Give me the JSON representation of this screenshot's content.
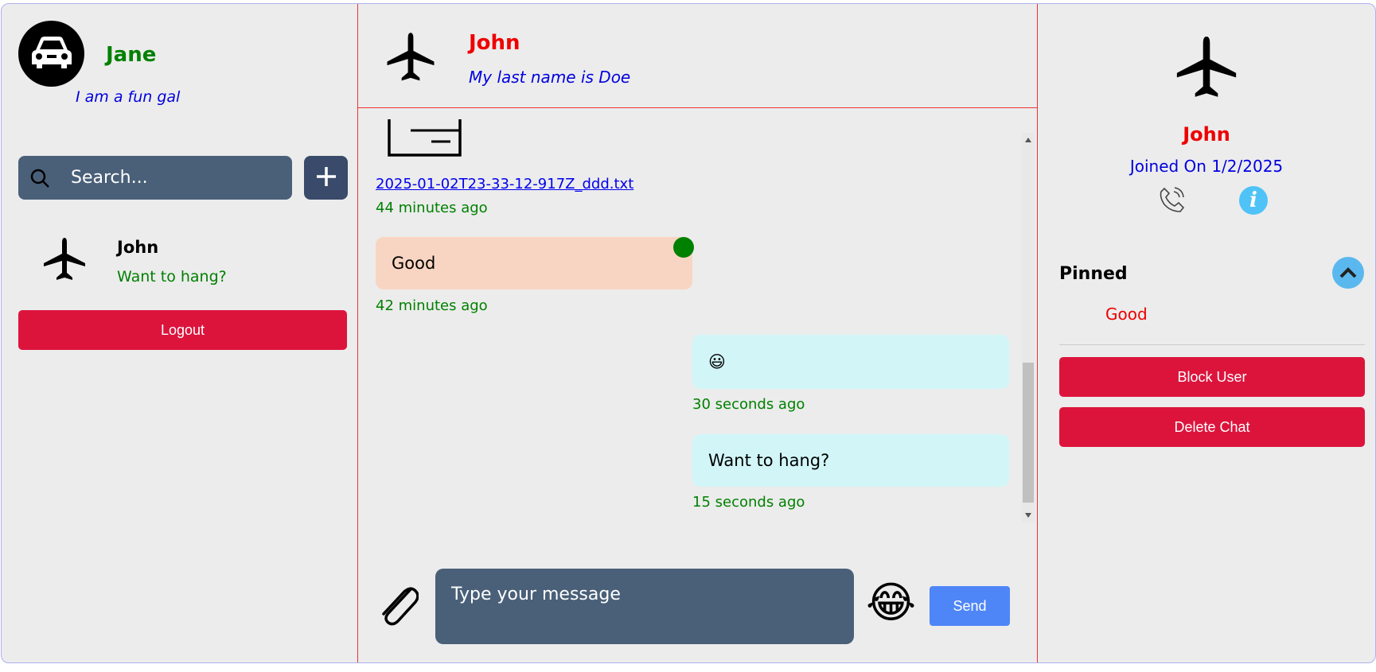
{
  "me": {
    "name": "Jane",
    "status": "I am a fun gal",
    "avatar_icon": "car-icon"
  },
  "search": {
    "placeholder": "Search..."
  },
  "contacts": [
    {
      "name": "John",
      "last_message": "Want to hang?",
      "avatar_icon": "airplane-icon"
    }
  ],
  "logout_label": "Logout",
  "chat": {
    "header": {
      "name": "John",
      "subtitle": "My last name is Doe"
    },
    "messages": [
      {
        "type": "file",
        "filename": "2025-01-02T23-33-12-917Z_ddd.txt",
        "time": "44 minutes ago",
        "direction": "in"
      },
      {
        "type": "text",
        "text": "Good",
        "time": "42 minutes ago",
        "direction": "in",
        "pinned": true
      },
      {
        "type": "text",
        "text": "😃",
        "time": "30 seconds ago",
        "direction": "out"
      },
      {
        "type": "text",
        "text": "Want to hang?",
        "time": "15 seconds ago",
        "direction": "out"
      }
    ],
    "composer": {
      "placeholder": "Type your message",
      "emoji": "😂",
      "send_label": "Send"
    }
  },
  "profile": {
    "name": "John",
    "joined": "Joined On 1/2/2025",
    "pinned_title": "Pinned",
    "pinned": [
      "Good"
    ],
    "block_label": "Block User",
    "delete_label": "Delete Chat"
  },
  "colors": {
    "danger": "#dc143c",
    "green": "#008000",
    "blue": "#0000e0",
    "input_bg": "#4a6079",
    "send": "#4f86f7"
  }
}
